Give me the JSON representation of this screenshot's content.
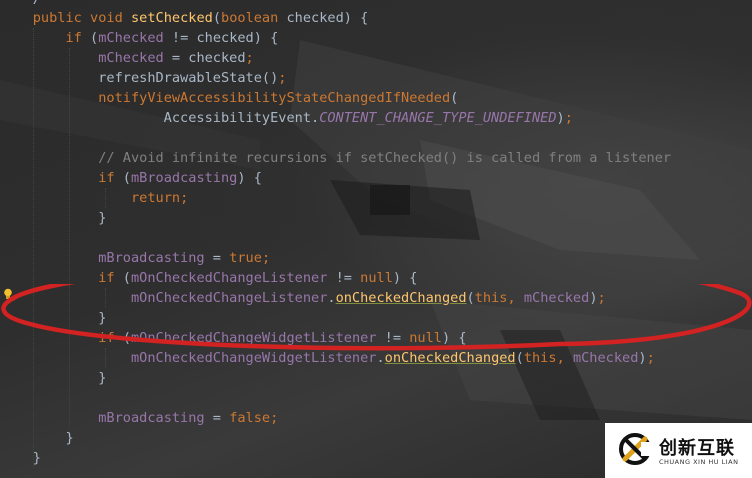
{
  "editor": {
    "language": "java",
    "code_lines": [
      "    /",
      "    public void setChecked(boolean checked) {",
      "        if (mChecked != checked) {",
      "            mChecked = checked;",
      "            refreshDrawableState();",
      "            notifyViewAccessibilityStateChangedIfNeeded(",
      "                    AccessibilityEvent.CONTENT_CHANGE_TYPE_UNDEFINED);",
      "",
      "            // Avoid infinite recursions if setChecked() is called from a listener",
      "            if (mBroadcasting) {",
      "                return;",
      "            }",
      "",
      "            mBroadcasting = true;",
      "            if (mOnCheckedChangeListener != null) {",
      "                mOnCheckedChangeListener.onCheckedChanged(this, mChecked);",
      "            }",
      "            if (mOnCheckedChangeWidgetListener != null) {",
      "                mOnCheckedChangeWidgetListener.onCheckedChanged(this, mChecked);",
      "            }",
      "",
      "            mBroadcasting = false;",
      "        }",
      "    }"
    ],
    "gutter_icon": "lightbulb-icon",
    "annotation": {
      "shape": "ellipse",
      "color": "#d32222",
      "encircles": "if (mOnCheckedChangeListener != null) block"
    }
  },
  "watermark": {
    "brand_cn": "创新互联",
    "brand_en": "CHUANG XIN HU LIAN",
    "logo_icon": "brand-x-logo-icon"
  }
}
